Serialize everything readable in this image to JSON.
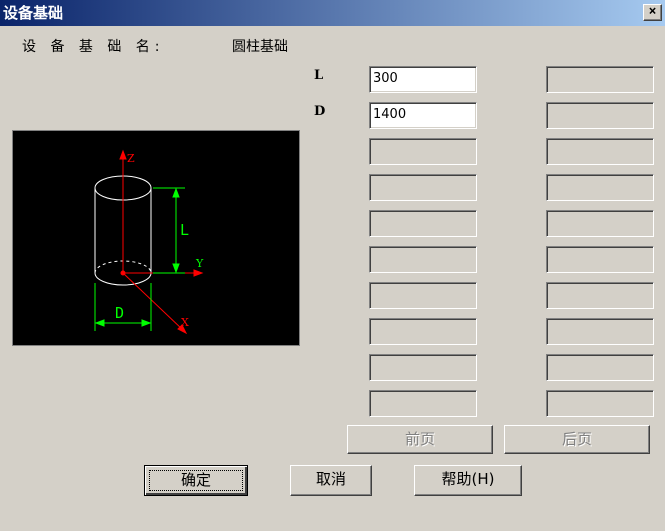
{
  "window": {
    "title": "设备基础",
    "close_glyph": "×"
  },
  "header": {
    "name_label": "设 备 基 础 名:",
    "name_value": "圆柱基础"
  },
  "params": [
    {
      "label": "L",
      "value": "300"
    },
    {
      "label": "D",
      "value": "1400"
    }
  ],
  "diagram": {
    "axis_z": "Z",
    "axis_y": "Y",
    "axis_x": "X",
    "dim_l": "L",
    "dim_d": "D"
  },
  "nav": {
    "prev_label": "前页",
    "next_label": "后页"
  },
  "buttons": {
    "ok_label": "确定",
    "cancel_label": "取消",
    "help_label": "帮助(H)"
  },
  "colors": {
    "title_start": "#0a246a",
    "title_end": "#a6caf0",
    "axis": "#ff0000",
    "dimension": "#00ff00",
    "outline": "#ffffff"
  }
}
